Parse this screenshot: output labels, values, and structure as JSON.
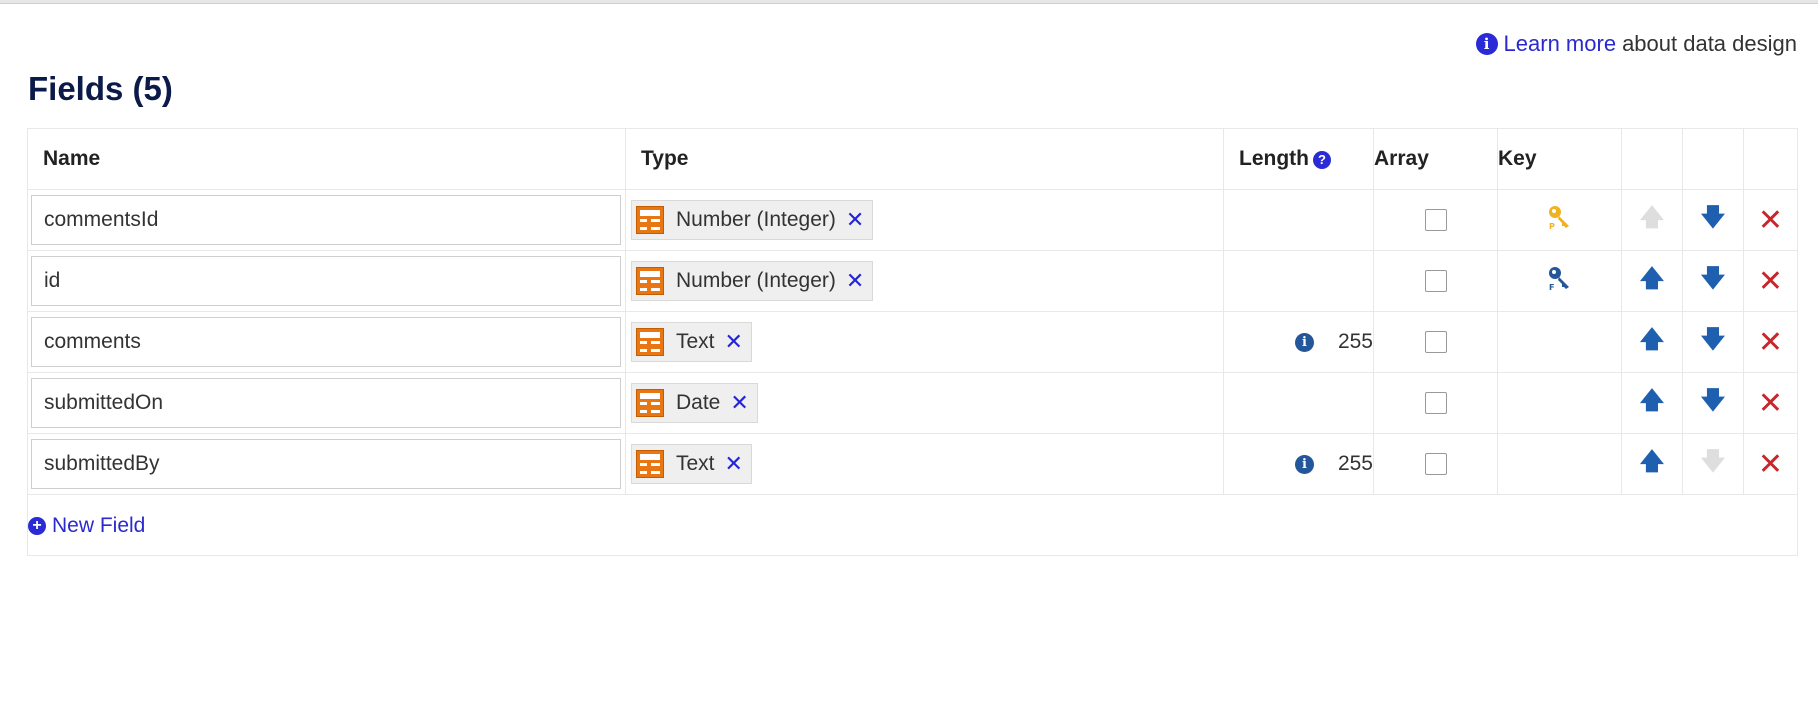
{
  "help": {
    "icon": "info-icon",
    "link_text": "Learn more",
    "suffix_text": "about data design"
  },
  "page": {
    "title": "Fields (5)"
  },
  "table": {
    "headers": {
      "name": "Name",
      "type": "Type",
      "length": "Length",
      "array": "Array",
      "key": "Key"
    },
    "rows": [
      {
        "name": "commentsId",
        "type": "Number (Integer)",
        "length": "",
        "array": false,
        "key": "primary",
        "move_up_enabled": false,
        "move_down_enabled": true
      },
      {
        "name": "id",
        "type": "Number (Integer)",
        "length": "",
        "array": false,
        "key": "foreign",
        "move_up_enabled": true,
        "move_down_enabled": true
      },
      {
        "name": "comments",
        "type": "Text",
        "length": "255",
        "array": false,
        "key": "",
        "move_up_enabled": true,
        "move_down_enabled": true
      },
      {
        "name": "submittedOn",
        "type": "Date",
        "length": "",
        "array": false,
        "key": "",
        "move_up_enabled": true,
        "move_down_enabled": true
      },
      {
        "name": "submittedBy",
        "type": "Text",
        "length": "255",
        "array": false,
        "key": "",
        "move_up_enabled": true,
        "move_down_enabled": false
      }
    ]
  },
  "actions": {
    "new_field": "New Field"
  },
  "colors": {
    "accent": "#2a2acf",
    "title": "#0c1a4a",
    "type_icon": "#e87612",
    "arrow": "#1f5fb0",
    "delete": "#c8262b",
    "primary_key": "#f0b21f",
    "foreign_key": "#24569a"
  },
  "icons": {
    "type": "field-type-icon",
    "chip_remove": "close-x-icon",
    "length_info": "info-icon",
    "length_help": "question-circle-icon",
    "primary_key": "primary-key-icon",
    "foreign_key": "foreign-key-icon",
    "move_up": "arrow-up-icon",
    "move_down": "arrow-down-icon",
    "delete": "delete-x-icon",
    "add": "plus-circle-icon"
  }
}
